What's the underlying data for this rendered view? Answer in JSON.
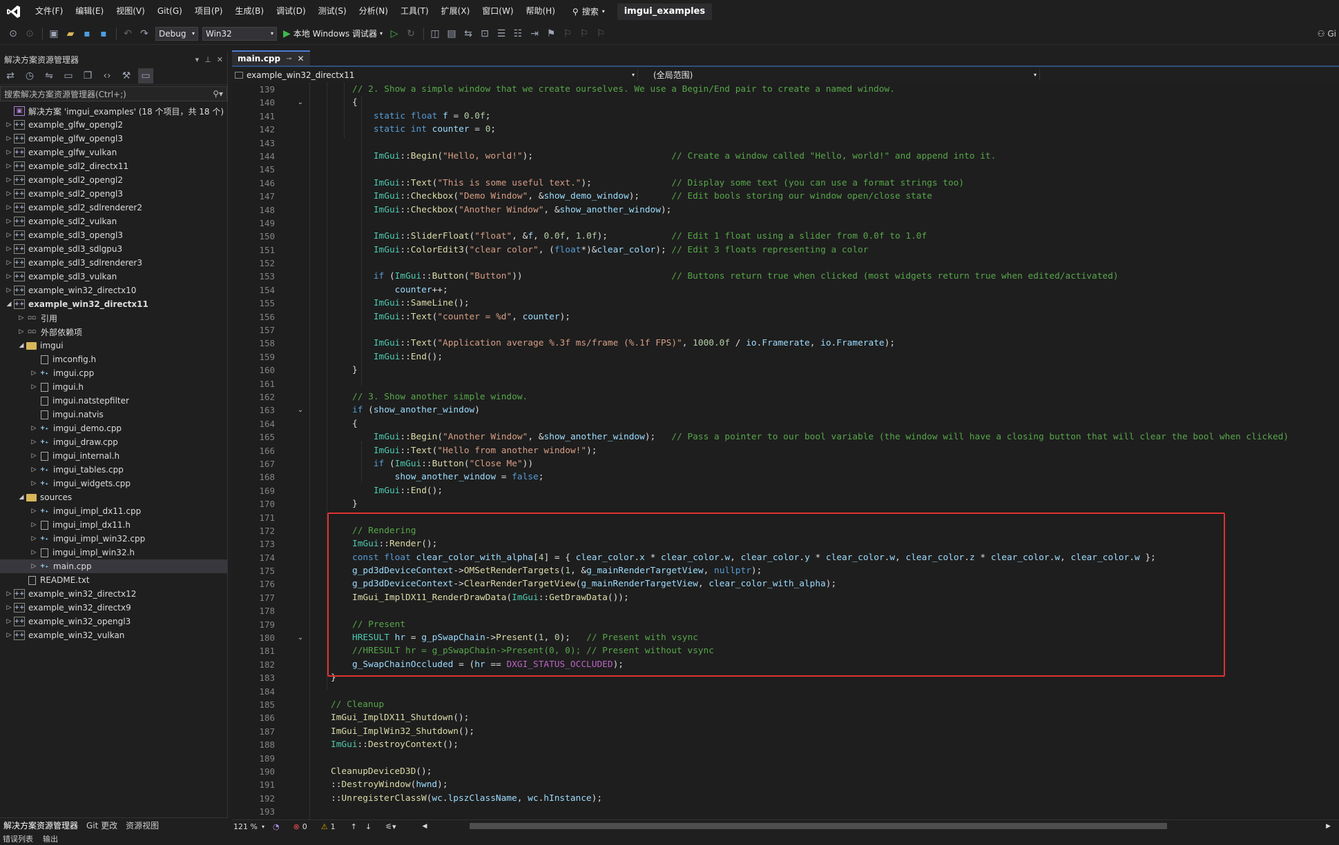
{
  "menubar": {
    "items": [
      "文件(F)",
      "编辑(E)",
      "视图(V)",
      "Git(G)",
      "项目(P)",
      "生成(B)",
      "调试(D)",
      "测试(S)",
      "分析(N)",
      "工具(T)",
      "扩展(X)",
      "窗口(W)",
      "帮助(H)"
    ],
    "search_label": "搜索",
    "solution_name": "imgui_examples"
  },
  "toolbar": {
    "config": "Debug",
    "platform": "Win32",
    "run_label": "本地 Windows 调试器",
    "account_label": "Gi"
  },
  "solution_explorer": {
    "title": "解决方案资源管理器",
    "search_placeholder": "搜索解决方案资源管理器(Ctrl+;)",
    "tree": [
      {
        "label": "解决方案 'imgui_examples' (18 个项目，共 18 个)",
        "depth": 0,
        "icon": "sol",
        "arrow": ""
      },
      {
        "label": "example_glfw_opengl2",
        "depth": 0,
        "icon": "proj",
        "arrow": "right"
      },
      {
        "label": "example_glfw_opengl3",
        "depth": 0,
        "icon": "proj",
        "arrow": "right"
      },
      {
        "label": "example_glfw_vulkan",
        "depth": 0,
        "icon": "proj",
        "arrow": "right"
      },
      {
        "label": "example_sdl2_directx11",
        "depth": 0,
        "icon": "proj",
        "arrow": "right"
      },
      {
        "label": "example_sdl2_opengl2",
        "depth": 0,
        "icon": "proj",
        "arrow": "right"
      },
      {
        "label": "example_sdl2_opengl3",
        "depth": 0,
        "icon": "proj",
        "arrow": "right"
      },
      {
        "label": "example_sdl2_sdlrenderer2",
        "depth": 0,
        "icon": "proj",
        "arrow": "right"
      },
      {
        "label": "example_sdl2_vulkan",
        "depth": 0,
        "icon": "proj",
        "arrow": "right"
      },
      {
        "label": "example_sdl3_opengl3",
        "depth": 0,
        "icon": "proj",
        "arrow": "right"
      },
      {
        "label": "example_sdl3_sdlgpu3",
        "depth": 0,
        "icon": "proj",
        "arrow": "right"
      },
      {
        "label": "example_sdl3_sdlrenderer3",
        "depth": 0,
        "icon": "proj",
        "arrow": "right"
      },
      {
        "label": "example_sdl3_vulkan",
        "depth": 0,
        "icon": "proj",
        "arrow": "right"
      },
      {
        "label": "example_win32_directx10",
        "depth": 0,
        "icon": "proj",
        "arrow": "right"
      },
      {
        "label": "example_win32_directx11",
        "depth": 0,
        "icon": "proj",
        "arrow": "down",
        "bold": true
      },
      {
        "label": "引用",
        "depth": 1,
        "icon": "ref",
        "arrow": "right"
      },
      {
        "label": "外部依赖项",
        "depth": 1,
        "icon": "ref",
        "arrow": "right"
      },
      {
        "label": "imgui",
        "depth": 1,
        "icon": "folder",
        "arrow": "down"
      },
      {
        "label": "imconfig.h",
        "depth": 2,
        "icon": "file",
        "arrow": ""
      },
      {
        "label": "imgui.cpp",
        "depth": 2,
        "icon": "cpp",
        "arrow": "right"
      },
      {
        "label": "imgui.h",
        "depth": 2,
        "icon": "file",
        "arrow": "right"
      },
      {
        "label": "imgui.natstepfilter",
        "depth": 2,
        "icon": "file",
        "arrow": ""
      },
      {
        "label": "imgui.natvis",
        "depth": 2,
        "icon": "file",
        "arrow": ""
      },
      {
        "label": "imgui_demo.cpp",
        "depth": 2,
        "icon": "cpp",
        "arrow": "right"
      },
      {
        "label": "imgui_draw.cpp",
        "depth": 2,
        "icon": "cpp",
        "arrow": "right"
      },
      {
        "label": "imgui_internal.h",
        "depth": 2,
        "icon": "file",
        "arrow": "right"
      },
      {
        "label": "imgui_tables.cpp",
        "depth": 2,
        "icon": "cpp",
        "arrow": "right"
      },
      {
        "label": "imgui_widgets.cpp",
        "depth": 2,
        "icon": "cpp",
        "arrow": "right"
      },
      {
        "label": "sources",
        "depth": 1,
        "icon": "folder",
        "arrow": "down"
      },
      {
        "label": "imgui_impl_dx11.cpp",
        "depth": 2,
        "icon": "cpp",
        "arrow": "right"
      },
      {
        "label": "imgui_impl_dx11.h",
        "depth": 2,
        "icon": "file",
        "arrow": "right"
      },
      {
        "label": "imgui_impl_win32.cpp",
        "depth": 2,
        "icon": "cpp",
        "arrow": "right"
      },
      {
        "label": "imgui_impl_win32.h",
        "depth": 2,
        "icon": "file",
        "arrow": "right"
      },
      {
        "label": "main.cpp",
        "depth": 2,
        "icon": "cpp",
        "arrow": "right",
        "selected": true
      },
      {
        "label": "README.txt",
        "depth": 1,
        "icon": "file",
        "arrow": ""
      },
      {
        "label": "example_win32_directx12",
        "depth": 0,
        "icon": "proj",
        "arrow": "right"
      },
      {
        "label": "example_win32_directx9",
        "depth": 0,
        "icon": "proj",
        "arrow": "right"
      },
      {
        "label": "example_win32_opengl3",
        "depth": 0,
        "icon": "proj",
        "arrow": "right"
      },
      {
        "label": "example_win32_vulkan",
        "depth": 0,
        "icon": "proj",
        "arrow": "right"
      }
    ],
    "bottom_tabs": [
      "解决方案资源管理器",
      "Git 更改",
      "资源视图"
    ]
  },
  "bottom_strip": [
    "错误列表",
    "输出"
  ],
  "editor": {
    "tab_label": "main.cpp",
    "nav_project": "example_win32_directx11",
    "nav_scope": "(全局范围)",
    "zoom": "121 %",
    "errors": "0",
    "warnings": "1",
    "first_line": 139,
    "fold_lines": [
      140,
      163,
      180
    ]
  },
  "code": [
    "<span class='cm'>// 2. Show a simple window that we create ourselves. We use a Begin/End pair to create a named window.</span>",
    "{",
    "    <span class='kw'>static</span> <span class='kw'>float</span> <span class='var'>f</span> = <span class='num'>0.0f</span>;",
    "    <span class='kw'>static</span> <span class='kw'>int</span> <span class='var'>counter</span> = <span class='num'>0</span>;",
    "",
    "    <span class='ty'>ImGui</span>::<span class='fn'>Begin</span>(<span class='st'>\"Hello, world!\"</span>);                          <span class='cm'>// Create a window called \"Hello, world!\" and append into it.</span>",
    "",
    "    <span class='ty'>ImGui</span>::<span class='fn'>Text</span>(<span class='st'>\"This is some useful text.\"</span>);               <span class='cm'>// Display some text (you can use a format strings too)</span>",
    "    <span class='ty'>ImGui</span>::<span class='fn'>Checkbox</span>(<span class='st'>\"Demo Window\"</span>, &amp;<span class='var'>show_demo_window</span>);      <span class='cm'>// Edit bools storing our window open/close state</span>",
    "    <span class='ty'>ImGui</span>::<span class='fn'>Checkbox</span>(<span class='st'>\"Another Window\"</span>, &amp;<span class='var'>show_another_window</span>);",
    "",
    "    <span class='ty'>ImGui</span>::<span class='fn'>SliderFloat</span>(<span class='st'>\"float\"</span>, &amp;<span class='var'>f</span>, <span class='num'>0.0f</span>, <span class='num'>1.0f</span>);            <span class='cm'>// Edit 1 float using a slider from 0.0f to 1.0f</span>",
    "    <span class='ty'>ImGui</span>::<span class='fn'>ColorEdit3</span>(<span class='st'>\"clear color\"</span>, (<span class='kw'>float</span>*)&amp;<span class='var'>clear_color</span>); <span class='cm'>// Edit 3 floats representing a color</span>",
    "",
    "    <span class='kw'>if</span> (<span class='ty'>ImGui</span>::<span class='fn'>Button</span>(<span class='st'>\"Button\"</span>))                            <span class='cm'>// Buttons return true when clicked (most widgets return true when edited/activated)</span>",
    "        <span class='var'>counter</span>++;",
    "    <span class='ty'>ImGui</span>::<span class='fn'>SameLine</span>();",
    "    <span class='ty'>ImGui</span>::<span class='fn'>Text</span>(<span class='st'>\"counter = %d\"</span>, <span class='var'>counter</span>);",
    "",
    "    <span class='ty'>ImGui</span>::<span class='fn'>Text</span>(<span class='st'>\"Application average %.3f ms/frame (%.1f FPS)\"</span>, <span class='num'>1000.0f</span> / <span class='var'>io</span>.<span class='var'>Framerate</span>, <span class='var'>io</span>.<span class='var'>Framerate</span>);",
    "    <span class='ty'>ImGui</span>::<span class='fn'>End</span>();",
    "}",
    "",
    "<span class='cm'>// 3. Show another simple window.</span>",
    "<span class='kw'>if</span> (<span class='var'>show_another_window</span>)",
    "{",
    "    <span class='ty'>ImGui</span>::<span class='fn'>Begin</span>(<span class='st'>\"Another Window\"</span>, &amp;<span class='var'>show_another_window</span>);   <span class='cm'>// Pass a pointer to our bool variable (the window will have a closing button that will clear the bool when clicked)</span>",
    "    <span class='ty'>ImGui</span>::<span class='fn'>Text</span>(<span class='st'>\"Hello from another window!\"</span>);",
    "    <span class='kw'>if</span> (<span class='ty'>ImGui</span>::<span class='fn'>Button</span>(<span class='st'>\"Close Me\"</span>))",
    "        <span class='var'>show_another_window</span> = <span class='kw'>false</span>;",
    "    <span class='ty'>ImGui</span>::<span class='fn'>End</span>();",
    "}",
    "",
    "<span class='cm'>// Rendering</span>",
    "<span class='ty'>ImGui</span>::<span class='fn'>Render</span>();",
    "<span class='kw'>const</span> <span class='kw'>float</span> <span class='var'>clear_color_with_alpha</span>[<span class='num'>4</span>] = { <span class='var'>clear_color</span>.<span class='var'>x</span> * <span class='var'>clear_color</span>.<span class='var'>w</span>, <span class='var'>clear_color</span>.<span class='var'>y</span> * <span class='var'>clear_color</span>.<span class='var'>w</span>, <span class='var'>clear_color</span>.<span class='var'>z</span> * <span class='var'>clear_color</span>.<span class='var'>w</span>, <span class='var'>clear_color</span>.<span class='var'>w</span> };",
    "<span class='var'>g_pd3dDeviceContext</span>-&gt;<span class='fn'>OMSetRenderTargets</span>(<span class='num'>1</span>, &amp;<span class='var'>g_mainRenderTargetView</span>, <span class='kw'>nullptr</span>);",
    "<span class='var'>g_pd3dDeviceContext</span>-&gt;<span class='fn'>ClearRenderTargetView</span>(<span class='var'>g_mainRenderTargetView</span>, <span class='var'>clear_color_with_alpha</span>);",
    "<span class='fn'>ImGui_ImplDX11_RenderDrawData</span>(<span class='ty'>ImGui</span>::<span class='fn'>GetDrawData</span>());",
    "",
    "<span class='cm'>// Present</span>",
    "<span class='ty'>HRESULT</span> <span class='var'>hr</span> = <span class='var'>g_pSwapChain</span>-&gt;<span class='fn'>Present</span>(<span class='num'>1</span>, <span class='num'>0</span>);   <span class='cm'>// Present with vsync</span>",
    "<span class='cm'>//HRESULT hr = g_pSwapChain-&gt;Present(0, 0); // Present without vsync</span>",
    "<span class='var'>g_SwapChainOccluded</span> = (<span class='var'>hr</span> == <span class='mac'>DXGI_STATUS_OCCLUDED</span>);",
    "}",
    "",
    "<span class='cm'>// Cleanup</span>",
    "<span class='fn'>ImGui_ImplDX11_Shutdown</span>();",
    "<span class='fn'>ImGui_ImplWin32_Shutdown</span>();",
    "<span class='ty'>ImGui</span>::<span class='fn'>DestroyContext</span>();",
    "",
    "<span class='fn'>CleanupDeviceD3D</span>();",
    "::<span class='fn'>DestroyWindow</span>(<span class='var'>hwnd</span>);",
    "::<span class='fn'>UnregisterClassW</span>(<span class='var'>wc</span>.<span class='var'>lpszClassName</span>, <span class='var'>wc</span>.<span class='var'>hInstance</span>);",
    ""
  ],
  "code_indent": [
    2,
    2,
    2,
    2,
    2,
    2,
    2,
    2,
    2,
    2,
    2,
    2,
    2,
    2,
    2,
    2,
    2,
    2,
    2,
    2,
    2,
    2,
    2,
    2,
    2,
    2,
    2,
    2,
    2,
    2,
    2,
    2,
    2,
    2,
    2,
    2,
    2,
    2,
    2,
    2,
    2,
    2,
    2,
    2,
    1,
    1,
    1,
    1,
    1,
    1,
    1,
    1,
    1,
    1,
    1
  ],
  "colors": {
    "keyword": "#569cd6",
    "comment": "#57a64a",
    "string": "#d69d85",
    "highlight_box": "#e03131"
  }
}
